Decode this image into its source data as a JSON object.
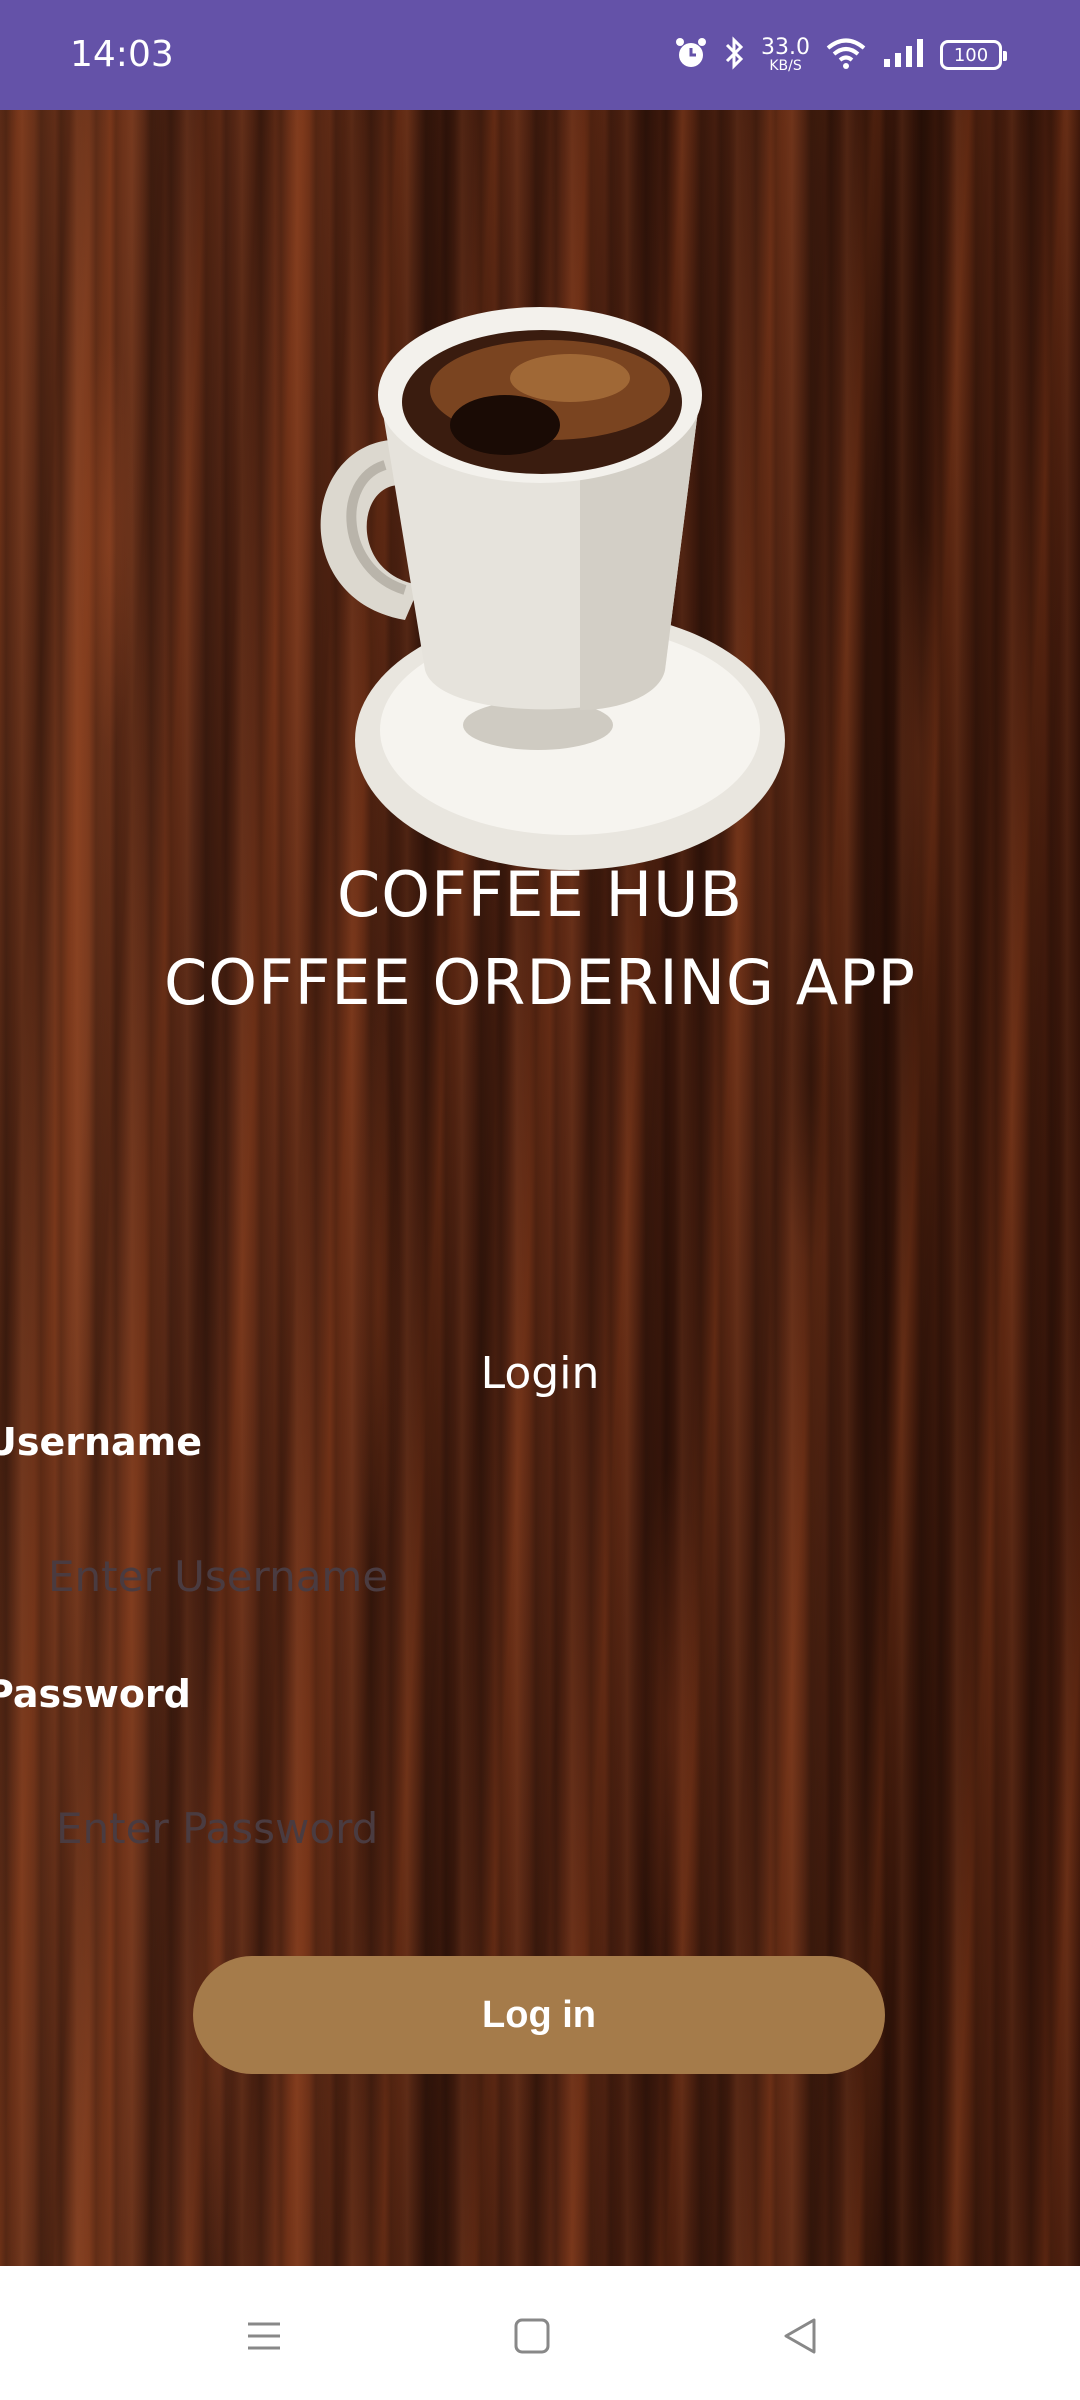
{
  "status_bar": {
    "time": "14:03",
    "net_speed_value": "33.0",
    "net_speed_unit": "KB/S",
    "battery": "100",
    "icons": [
      "alarm-icon",
      "bluetooth-icon",
      "wifi-icon",
      "signal-icon",
      "battery-icon"
    ]
  },
  "app": {
    "title_line1": "COFFEE HUB",
    "title_line2": "COFFEE ORDERING APP",
    "illustration": "coffee-cup-icon"
  },
  "login": {
    "heading": "Login",
    "username_label": "Username",
    "username_placeholder": "Enter Username",
    "username_value": "",
    "password_label": "Password",
    "password_placeholder": "Enter Password",
    "password_value": "",
    "button_label": "Log in"
  },
  "colors": {
    "status_bar": "#6452a8",
    "button": "#a57b4a",
    "placeholder": "#4a3b40"
  },
  "nav_bar": {
    "buttons": [
      "menu-icon",
      "home-icon",
      "back-icon"
    ]
  }
}
